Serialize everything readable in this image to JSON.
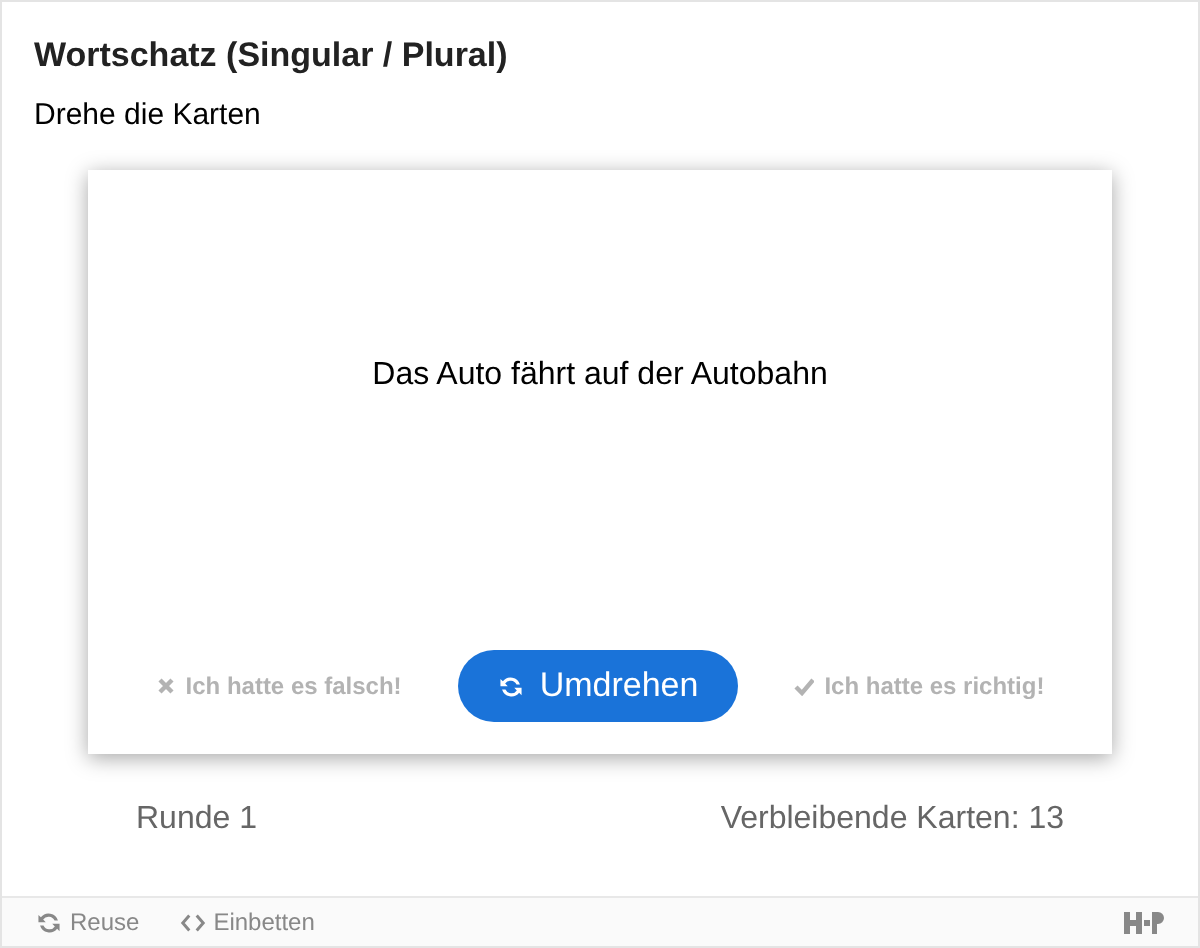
{
  "title": "Wortschatz (Singular / Plural)",
  "instruction": "Drehe die Karten",
  "card": {
    "text": "Das Auto fährt auf der Autobahn"
  },
  "buttons": [
    {
      "kind": "wrong",
      "label": "Ich hatte es falsch!",
      "disabled": true
    },
    {
      "kind": "flip",
      "label": "Umdrehen",
      "disabled": false
    },
    {
      "kind": "right",
      "label": "Ich hatte es richtig!",
      "disabled": true
    }
  ],
  "progress": {
    "round": "Runde 1",
    "remaining": "Verbleibende Karten: 13"
  },
  "footer": [
    {
      "kind": "reuse",
      "label": "Reuse"
    },
    {
      "kind": "embed",
      "label": "Einbetten"
    }
  ]
}
